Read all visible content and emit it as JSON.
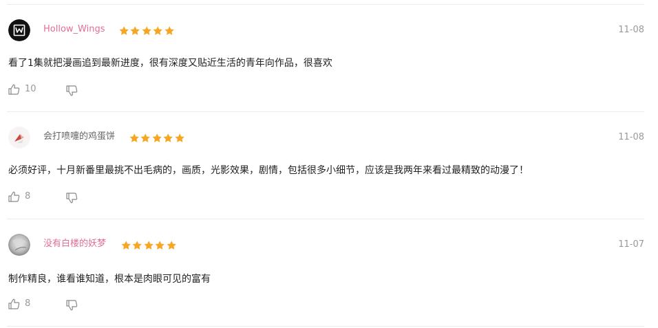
{
  "reviews": [
    {
      "user": "Hollow_Wings",
      "user_color": "#e46d95",
      "rating": 5,
      "date": "11-08",
      "text": "看了1集就把漫画追到最新进度，很有深度又贴近生活的青年向作品，很喜欢",
      "likes": "10"
    },
    {
      "user": "会打喷嚏的鸡蛋饼",
      "user_color": "#666666",
      "rating": 5,
      "date": "11-08",
      "text": "必须好评，十月新番里最挑不出毛病的，画质，光影效果，剧情，包括很多小细节，应该是我两年来看过最精致的动漫了！",
      "likes": "8"
    },
    {
      "user": "没有白楼的妖梦",
      "user_color": "#e46d95",
      "rating": 5,
      "date": "11-07",
      "text": "制作精良，谁看谁知道，根本是肉眼可见的富有",
      "likes": "8"
    }
  ],
  "colors": {
    "star": "#f5a623",
    "meta": "#999999",
    "divider": "#ececec"
  },
  "icons": {
    "like": "thumbs-up-icon",
    "dislike": "thumbs-down-icon"
  }
}
